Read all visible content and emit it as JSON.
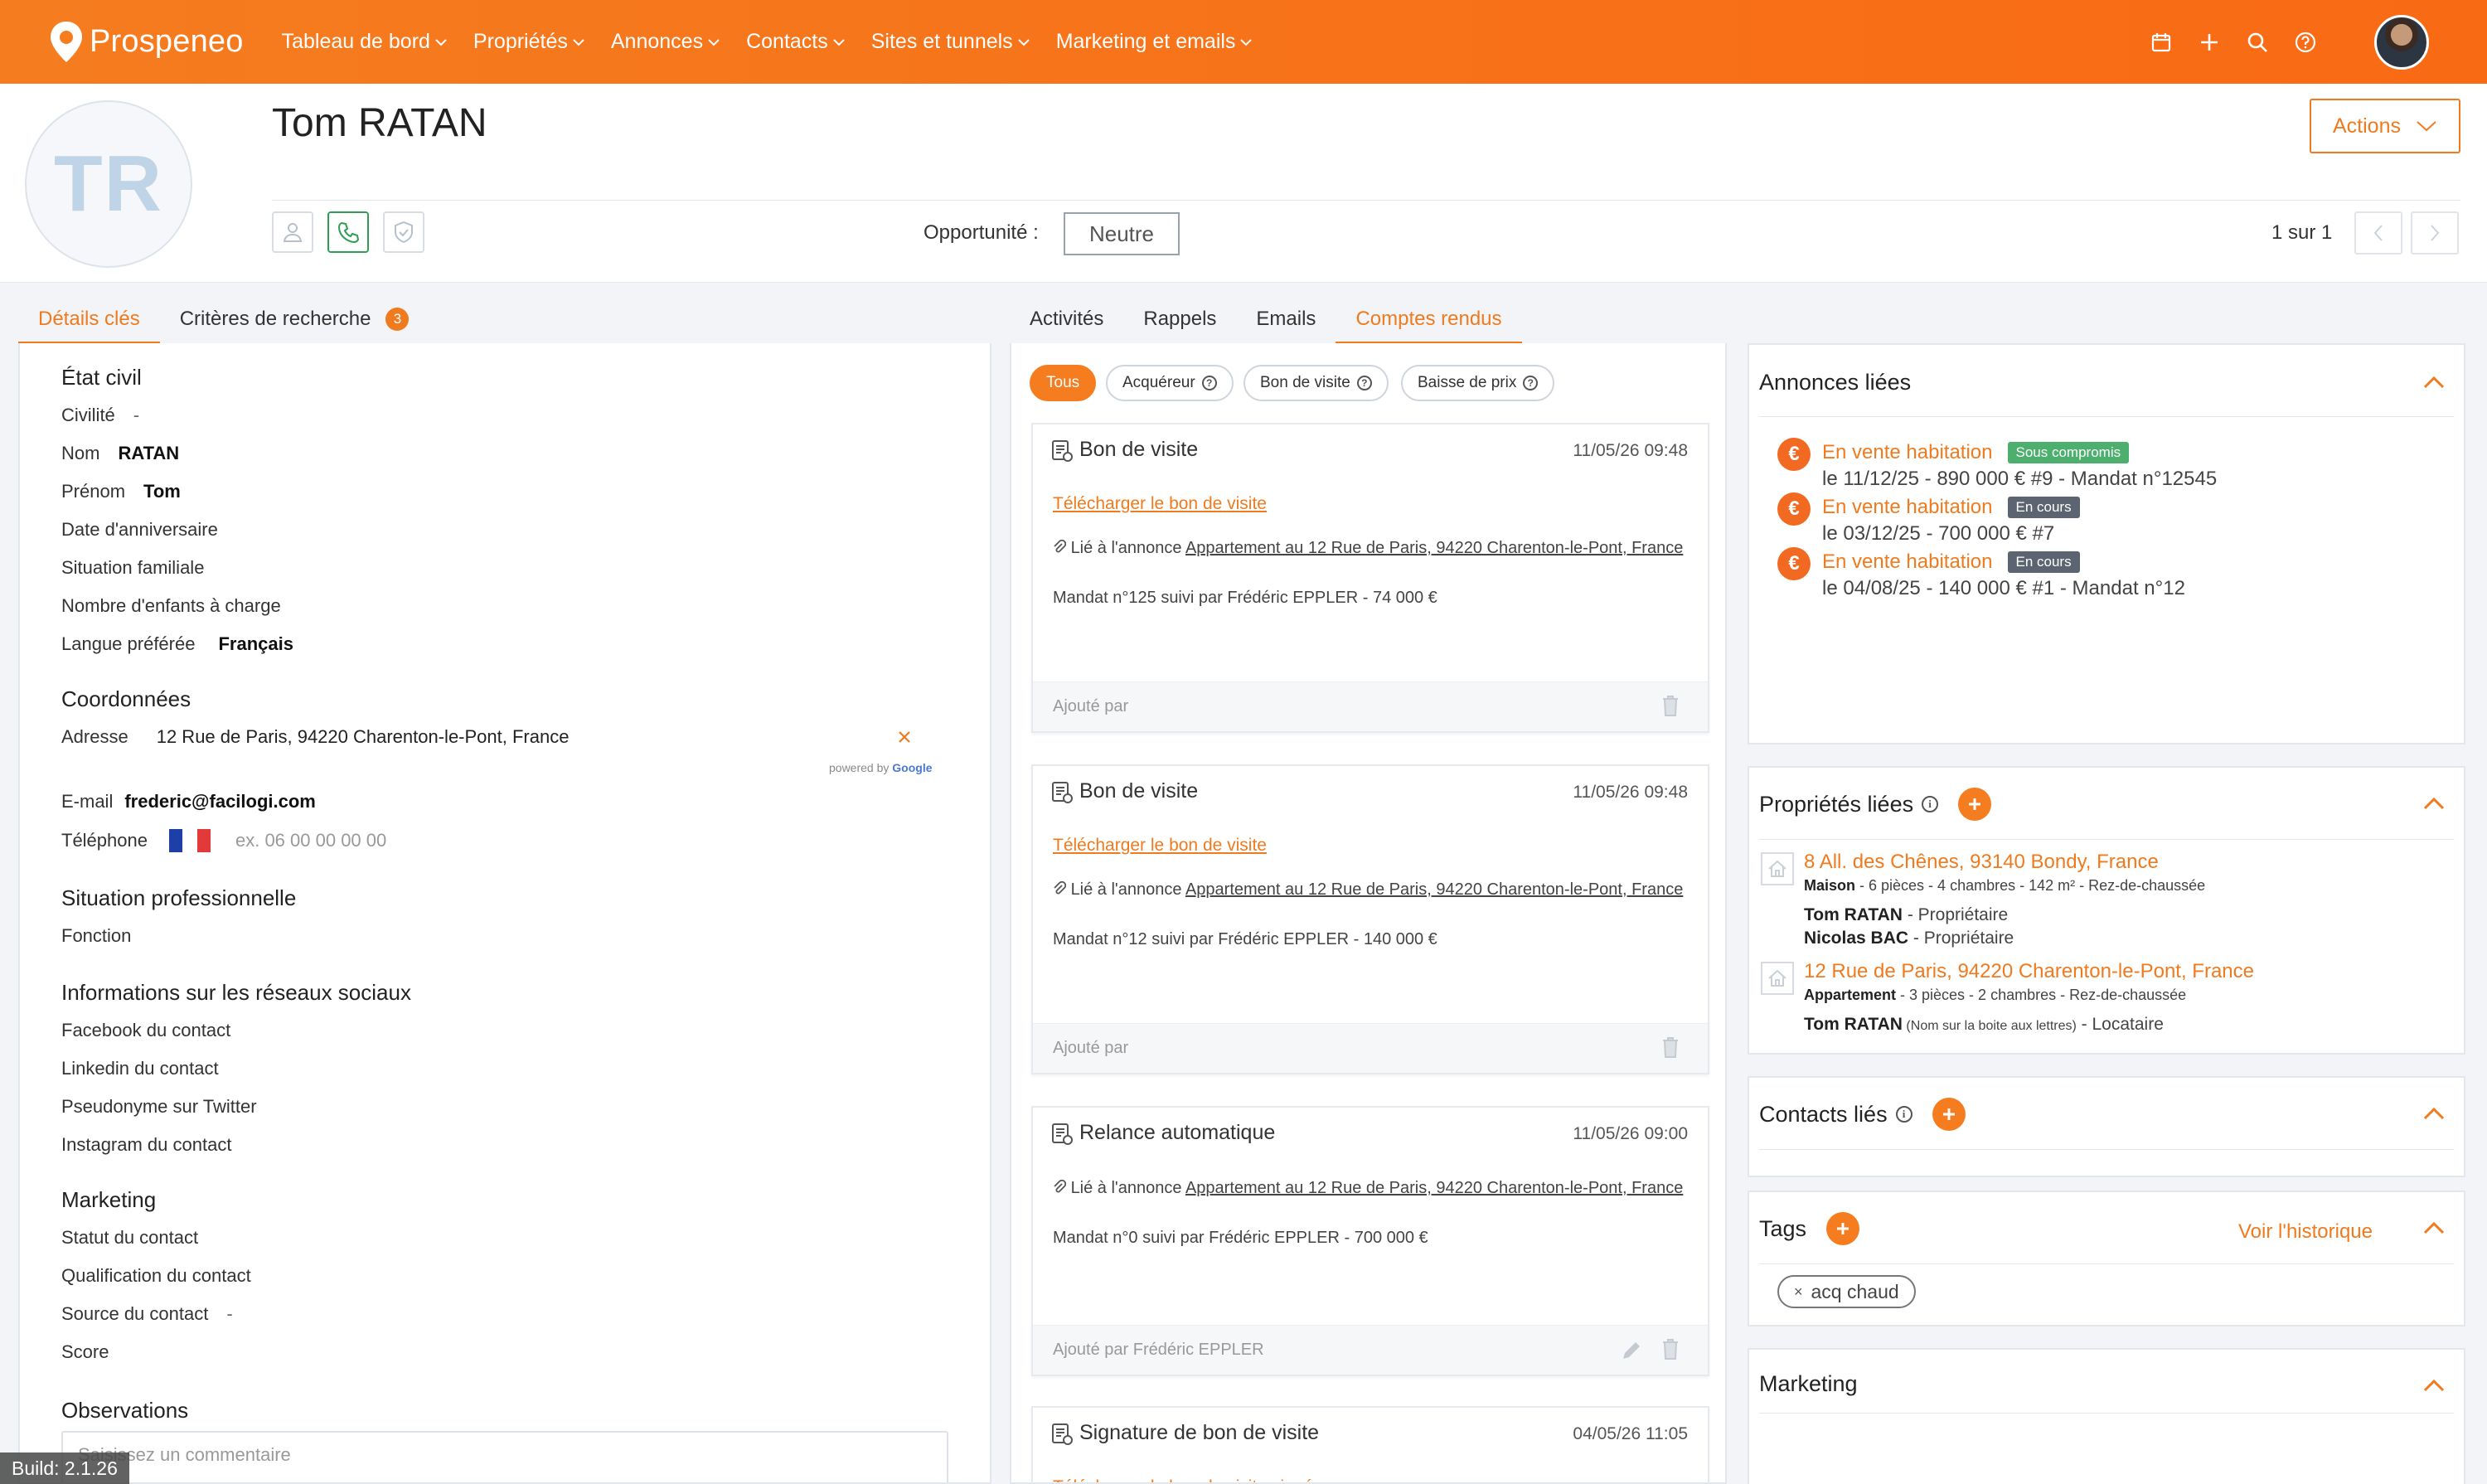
{
  "app": {
    "brand": "Prospeneo",
    "build": "Build: 2.1.26"
  },
  "nav": {
    "items": [
      "Tableau de bord",
      "Propriétés",
      "Annonces",
      "Contacts",
      "Sites et tunnels",
      "Marketing et emails"
    ]
  },
  "top_icons": [
    "calendar-icon",
    "plus-icon",
    "search-icon",
    "help-icon"
  ],
  "contact": {
    "initials": "TR",
    "name": "Tom RATAN",
    "opportunity_label": "Opportunité :",
    "opportunity_value": "Neutre",
    "pager": "1 sur 1",
    "actions_label": "Actions"
  },
  "left_tabs": {
    "details": "Détails clés",
    "criteria": "Critères de recherche",
    "criteria_count": "3"
  },
  "mid_tabs": [
    "Activités",
    "Rappels",
    "Emails",
    "Comptes rendus"
  ],
  "details": {
    "etat_civil": {
      "title": "État civil",
      "civilite_label": "Civilité",
      "civilite_value": "-",
      "nom_label": "Nom",
      "nom_value": "RATAN",
      "prenom_label": "Prénom",
      "prenom_value": "Tom",
      "anniv_label": "Date d'anniversaire",
      "situation_label": "Situation familiale",
      "enfants_label": "Nombre d'enfants à charge",
      "langue_label": "Langue préférée",
      "langue_value": "Français"
    },
    "coordonnees": {
      "title": "Coordonnées",
      "adresse_label": "Adresse",
      "adresse_value": "12 Rue de Paris, 94220 Charenton-le-Pont, France",
      "powered": "powered by",
      "google": "Google",
      "email_label": "E-mail",
      "email_value": "frederic@facilogi.com",
      "tel_label": "Téléphone",
      "tel_placeholder": "ex. 06 00 00 00 00"
    },
    "pro": {
      "title": "Situation professionnelle",
      "fonction_label": "Fonction"
    },
    "social": {
      "title": "Informations sur les réseaux sociaux",
      "facebook": "Facebook du contact",
      "linkedin": "Linkedin du contact",
      "twitter": "Pseudonyme sur Twitter",
      "instagram": "Instagram du contact"
    },
    "marketing": {
      "title": "Marketing",
      "statut": "Statut du contact",
      "qualification": "Qualification du contact",
      "source_label": "Source du contact",
      "source_value": "-",
      "score": "Score"
    },
    "observations": {
      "title": "Observations",
      "placeholder": "Saisissez un commentaire"
    }
  },
  "filters": {
    "tous": "Tous",
    "acquereur": "Acquéreur",
    "bon_visite": "Bon de visite",
    "baisse_prix": "Baisse de prix"
  },
  "reports": [
    {
      "title": "Bon de visite",
      "date": "11/05/26 09:48",
      "link": "Télécharger le bon de visite",
      "rel_prefix": "Lié à l'annonce ",
      "rel_link": "Appartement au 12 Rue de Paris, 94220 Charenton-le-Pont, France",
      "mandat": "Mandat n°125 suivi par Frédéric EPPLER - 74 000 €",
      "added": "Ajouté par"
    },
    {
      "title": "Bon de visite",
      "date": "11/05/26 09:48",
      "link": "Télécharger le bon de visite",
      "rel_prefix": "Lié à l'annonce ",
      "rel_link": "Appartement au 12 Rue de Paris, 94220 Charenton-le-Pont, France",
      "mandat": "Mandat n°12 suivi par Frédéric EPPLER - 140 000 €",
      "added": "Ajouté par"
    },
    {
      "title": "Relance automatique",
      "date": "11/05/26 09:00",
      "rel_prefix": "Lié à l'annonce ",
      "rel_link": "Appartement au 12 Rue de Paris, 94220 Charenton-le-Pont, France",
      "mandat": "Mandat n°0 suivi par Frédéric EPPLER - 700 000 €",
      "added": "Ajouté par Frédéric EPPLER"
    },
    {
      "title": "Signature de bon de visite",
      "date": "04/05/26 11:05",
      "link": "Télécharger le bon de visite signé"
    }
  ],
  "annonces": {
    "title": "Annonces liées",
    "items": [
      {
        "label": "En vente habitation",
        "status": "Sous compromis",
        "detail": "le 11/12/25 - 890 000 € #9 - Mandat n°12545"
      },
      {
        "label": "En vente habitation",
        "status": "En cours",
        "detail": "le 03/12/25 - 700 000 € #7"
      },
      {
        "label": "En vente habitation",
        "status": "En cours",
        "detail": "le 04/08/25 - 140 000 € #1 - Mandat n°12"
      }
    ]
  },
  "proprietes": {
    "title": "Propriétés liées",
    "items": [
      {
        "address": "8 All. des Chênes, 93140 Bondy, France",
        "type": "Maison",
        "desc": " - 6 pièces - 4 chambres - 142 m² - Rez-de-chaussée",
        "owners": [
          {
            "name": "Tom RATAN",
            "role": " - Propriétaire"
          },
          {
            "name": "Nicolas BAC",
            "role": " - Propriétaire"
          }
        ]
      },
      {
        "address": "12 Rue de Paris, 94220 Charenton-le-Pont, France",
        "type": "Appartement",
        "desc": " - 3 pièces - 2 chambres - Rez-de-chaussée",
        "owner_name": "Tom RATAN",
        "owner_note": " (Nom sur la boite aux lettres)",
        "owner_role": " - Locataire"
      }
    ]
  },
  "contacts_lies": {
    "title": "Contacts liés"
  },
  "tags": {
    "title": "Tags",
    "history": "Voir l'historique",
    "items": [
      "acq chaud"
    ]
  },
  "marketing_box": {
    "title": "Marketing"
  },
  "colors": {
    "accent": "#f57c1f",
    "status_green": "#4caf6e",
    "status_dark": "#5b6470"
  }
}
